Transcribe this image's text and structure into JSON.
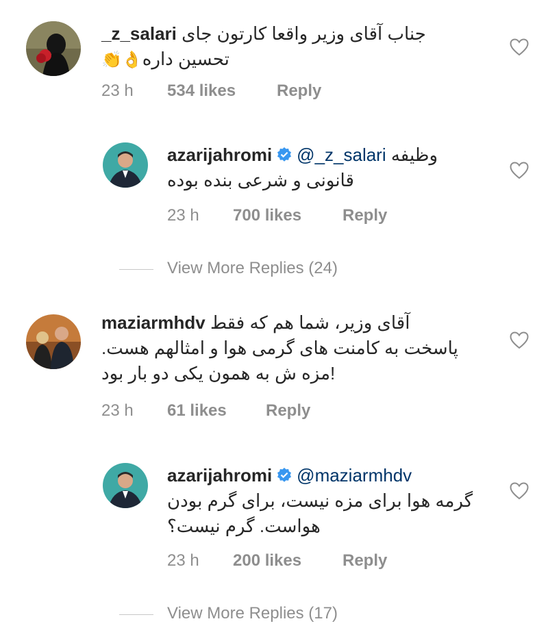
{
  "comments": [
    {
      "username": "_z_salari",
      "line1": "جناب آقای وزیر واقعا کارتون جای",
      "line2": "تحسین داره",
      "emoji": "👏👌",
      "time": "23 h",
      "likes": "534 likes",
      "reply": "Reply"
    },
    {
      "username": "azarijahromi",
      "mention": "@_z_salari",
      "line1": "وظیفه",
      "line2": "قانونی و شرعی بنده بوده",
      "time": "23 h",
      "likes": "700 likes",
      "reply": "Reply"
    },
    {
      "username": "maziarmhdv",
      "line1": "آقای وزیر، شما هم که فقط",
      "line2": "پاسخت به کامنت های گرمی هوا و امثالهم هست.",
      "line3": "!مزه ش به همون یکی دو بار بود",
      "time": "23 h",
      "likes": "61 likes",
      "reply": "Reply"
    },
    {
      "username": "azarijahromi",
      "mention": "@maziarmhdv",
      "line1": "گرمه هوا برای مزه نیست، برای گرم بودن",
      "line2": "هواست. گرم نیست؟",
      "time": "23 h",
      "likes": "200 likes",
      "reply": "Reply"
    }
  ],
  "view_more": [
    "View More Replies (24)",
    "View More Replies (17)"
  ],
  "colors": {
    "text": "#262626",
    "meta": "#8e8e8e",
    "mention": "#003569",
    "verified": "#3897f0"
  },
  "icons": [
    "heart-icon",
    "verified-badge-icon"
  ]
}
